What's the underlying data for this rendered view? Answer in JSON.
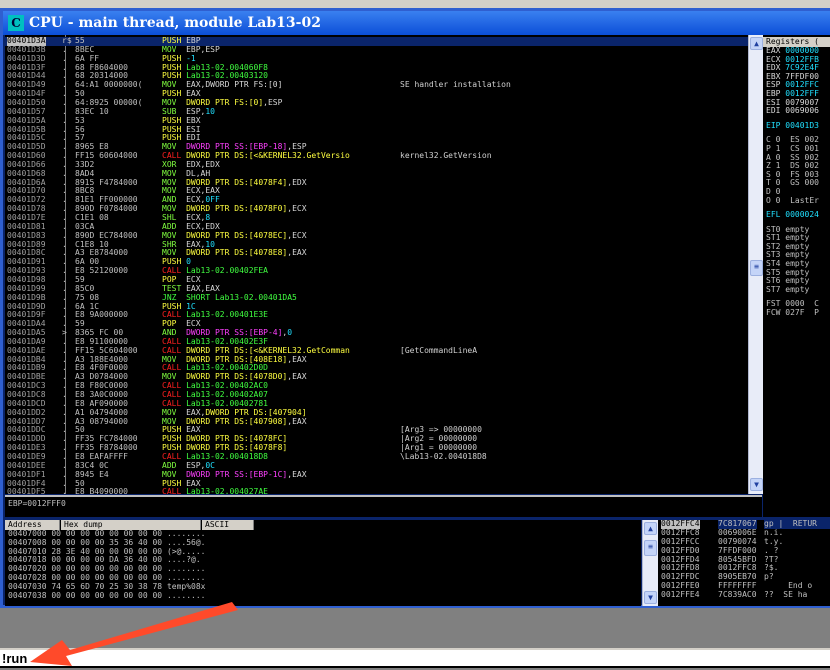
{
  "window": {
    "title": "CPU - main thread, module Lab13-02",
    "icon": "C"
  },
  "disasm": [
    [
      "00401D3A",
      "r$",
      "55",
      "PUSH",
      [
        [
          "EBP",
          "w"
        ]
      ],
      ""
    ],
    [
      "00401D3B",
      ".",
      "8BEC",
      "MOV",
      [
        [
          "EBP,ESP",
          "w"
        ]
      ],
      ""
    ],
    [
      "00401D3D",
      ".",
      "6A FF",
      "PUSH",
      [
        [
          "-1",
          "c"
        ]
      ],
      ""
    ],
    [
      "00401D3F",
      ".",
      "68 F8604000",
      "PUSH",
      [
        [
          "Lab13-02.004060F8",
          "g"
        ]
      ],
      ""
    ],
    [
      "00401D44",
      ".",
      "68 20314000",
      "PUSH",
      [
        [
          "Lab13-02.00403120",
          "g"
        ]
      ],
      ""
    ],
    [
      "00401D49",
      ".",
      "64:A1 0000000(",
      "MOV",
      [
        [
          "EAX,DWORD PTR FS:[0]",
          "w"
        ]
      ],
      "SE handler installation"
    ],
    [
      "00401D4F",
      ".",
      "50",
      "PUSH",
      [
        [
          "EAX",
          "w"
        ]
      ],
      ""
    ],
    [
      "00401D50",
      ".",
      "64:8925 00000(",
      "MOV",
      [
        [
          "DWORD PTR FS:[0]",
          "y"
        ],
        [
          ",ESP",
          "w"
        ]
      ],
      ""
    ],
    [
      "00401D57",
      ".",
      "83EC 10",
      "SUB",
      [
        [
          "ESP,",
          "w"
        ],
        [
          "10",
          "c"
        ]
      ],
      ""
    ],
    [
      "00401D5A",
      ".",
      "53",
      "PUSH",
      [
        [
          "EBX",
          "w"
        ]
      ],
      ""
    ],
    [
      "00401D5B",
      ".",
      "56",
      "PUSH",
      [
        [
          "ESI",
          "w"
        ]
      ],
      ""
    ],
    [
      "00401D5C",
      ".",
      "57",
      "PUSH",
      [
        [
          "EDI",
          "w"
        ]
      ],
      ""
    ],
    [
      "00401D5D",
      ".",
      "8965 E8",
      "MOV",
      [
        [
          "DWORD PTR SS:[EBP-18]",
          "m"
        ],
        [
          ",ESP",
          "w"
        ]
      ],
      ""
    ],
    [
      "00401D60",
      ".",
      "FF15 60604000",
      "CALL",
      [
        [
          "DWORD PTR DS:[<&KERNEL32.GetVersio",
          "y"
        ]
      ],
      "kernel32.GetVersion"
    ],
    [
      "00401D66",
      ".",
      "33D2",
      "XOR",
      [
        [
          "EDX,EDX",
          "w"
        ]
      ],
      ""
    ],
    [
      "00401D68",
      ".",
      "8AD4",
      "MOV",
      [
        [
          "DL,AH",
          "w"
        ]
      ],
      ""
    ],
    [
      "00401D6A",
      ".",
      "8915 F4784000",
      "MOV",
      [
        [
          "DWORD PTR DS:[4078F4]",
          "y"
        ],
        [
          ",EDX",
          "w"
        ]
      ],
      ""
    ],
    [
      "00401D70",
      ".",
      "8BC8",
      "MOV",
      [
        [
          "ECX,EAX",
          "w"
        ]
      ],
      ""
    ],
    [
      "00401D72",
      ".",
      "81E1 FF000000",
      "AND",
      [
        [
          "ECX,",
          "w"
        ],
        [
          "0FF",
          "c"
        ]
      ],
      ""
    ],
    [
      "00401D78",
      ".",
      "890D F0784000",
      "MOV",
      [
        [
          "DWORD PTR DS:[4078F0]",
          "y"
        ],
        [
          ",ECX",
          "w"
        ]
      ],
      ""
    ],
    [
      "00401D7E",
      ".",
      "C1E1 08",
      "SHL",
      [
        [
          "ECX,",
          "w"
        ],
        [
          "8",
          "c"
        ]
      ],
      ""
    ],
    [
      "00401D81",
      ".",
      "03CA",
      "ADD",
      [
        [
          "ECX,EDX",
          "w"
        ]
      ],
      ""
    ],
    [
      "00401D83",
      ".",
      "890D EC784000",
      "MOV",
      [
        [
          "DWORD PTR DS:[4078EC]",
          "y"
        ],
        [
          ",ECX",
          "w"
        ]
      ],
      ""
    ],
    [
      "00401D89",
      ".",
      "C1E8 10",
      "SHR",
      [
        [
          "EAX,",
          "w"
        ],
        [
          "10",
          "c"
        ]
      ],
      ""
    ],
    [
      "00401D8C",
      ".",
      "A3 E8784000",
      "MOV",
      [
        [
          "DWORD PTR DS:[4078E8]",
          "y"
        ],
        [
          ",EAX",
          "w"
        ]
      ],
      ""
    ],
    [
      "00401D91",
      ".",
      "6A 00",
      "PUSH",
      [
        [
          "0",
          "c"
        ]
      ],
      ""
    ],
    [
      "00401D93",
      ".",
      "E8 52120000",
      "CALL",
      [
        [
          "Lab13-02.00402FEA",
          "g"
        ]
      ],
      ""
    ],
    [
      "00401D98",
      ".",
      "59",
      "POP",
      [
        [
          "ECX",
          "w"
        ]
      ],
      ""
    ],
    [
      "00401D99",
      ".",
      "85C0",
      "TEST",
      [
        [
          "EAX,EAX",
          "w"
        ]
      ],
      ""
    ],
    [
      "00401D9B",
      ".",
      "75 08",
      "JNZ",
      [
        [
          "SHORT Lab13-02.00401DA5",
          "g"
        ]
      ],
      ""
    ],
    [
      "00401D9D",
      ".",
      "6A 1C",
      "PUSH",
      [
        [
          "1C",
          "c"
        ]
      ],
      ""
    ],
    [
      "00401D9F",
      ".",
      "E8 9A000000",
      "CALL",
      [
        [
          "Lab13-02.00401E3E",
          "g"
        ]
      ],
      ""
    ],
    [
      "00401DA4",
      ".",
      "59",
      "POP",
      [
        [
          "ECX",
          "w"
        ]
      ],
      ""
    ],
    [
      "00401DA5",
      ">",
      "8365 FC 00",
      "AND",
      [
        [
          "DWORD PTR SS:[EBP-4]",
          "m"
        ],
        [
          ",",
          "w"
        ],
        [
          "0",
          "c"
        ]
      ],
      ""
    ],
    [
      "00401DA9",
      ".",
      "E8 91100000",
      "CALL",
      [
        [
          "Lab13-02.00402E3F",
          "g"
        ]
      ],
      ""
    ],
    [
      "00401DAE",
      ".",
      "FF15 5C604000",
      "CALL",
      [
        [
          "DWORD PTR DS:[<&KERNEL32.GetComman",
          "y"
        ]
      ],
      "[GetCommandLineA"
    ],
    [
      "00401DB4",
      ".",
      "A3 188E4000",
      "MOV",
      [
        [
          "DWORD PTR DS:[408E18]",
          "y"
        ],
        [
          ",EAX",
          "w"
        ]
      ],
      ""
    ],
    [
      "00401DB9",
      ".",
      "E8 4F0F0000",
      "CALL",
      [
        [
          "Lab13-02.00402D0D",
          "g"
        ]
      ],
      ""
    ],
    [
      "00401DBE",
      ".",
      "A3 D0784000",
      "MOV",
      [
        [
          "DWORD PTR DS:[4078D0]",
          "y"
        ],
        [
          ",EAX",
          "w"
        ]
      ],
      ""
    ],
    [
      "00401DC3",
      ".",
      "E8 F80C0000",
      "CALL",
      [
        [
          "Lab13-02.00402AC0",
          "g"
        ]
      ],
      ""
    ],
    [
      "00401DC8",
      ".",
      "E8 3A0C0000",
      "CALL",
      [
        [
          "Lab13-02.00402A07",
          "g"
        ]
      ],
      ""
    ],
    [
      "00401DCD",
      ".",
      "E8 AF090000",
      "CALL",
      [
        [
          "Lab13-02.00402781",
          "g"
        ]
      ],
      ""
    ],
    [
      "00401DD2",
      ".",
      "A1 04794000",
      "MOV",
      [
        [
          "EAX,",
          "w"
        ],
        [
          "DWORD PTR DS:[407904]",
          "y"
        ]
      ],
      ""
    ],
    [
      "00401DD7",
      ".",
      "A3 08794000",
      "MOV",
      [
        [
          "DWORD PTR DS:[407908]",
          "y"
        ],
        [
          ",EAX",
          "w"
        ]
      ],
      ""
    ],
    [
      "00401DDC",
      ".",
      "50",
      "PUSH",
      [
        [
          "EAX",
          "w"
        ]
      ],
      "[Arg3 => 00000000"
    ],
    [
      "00401DDD",
      ".",
      "FF35 FC784000",
      "PUSH",
      [
        [
          "DWORD PTR DS:[4078FC]",
          "y"
        ]
      ],
      "|Arg2 = 00000000"
    ],
    [
      "00401DE3",
      ".",
      "FF35 F8784000",
      "PUSH",
      [
        [
          "DWORD PTR DS:[4078F8]",
          "y"
        ]
      ],
      "|Arg1 = 00000000"
    ],
    [
      "00401DE9",
      ".",
      "E8 EAFAFFFF",
      "CALL",
      [
        [
          "Lab13-02.004018D8",
          "g"
        ]
      ],
      "\\Lab13-02.004018D8"
    ],
    [
      "00401DEE",
      ".",
      "83C4 0C",
      "ADD",
      [
        [
          "ESP,",
          "w"
        ],
        [
          "0C",
          "c"
        ]
      ],
      ""
    ],
    [
      "00401DF1",
      ".",
      "8945 E4",
      "MOV",
      [
        [
          "DWORD PTR SS:[EBP-1C]",
          "m"
        ],
        [
          ",EAX",
          "w"
        ]
      ],
      ""
    ],
    [
      "00401DF4",
      ".",
      "50",
      "PUSH",
      [
        [
          "EAX",
          "w"
        ]
      ],
      ""
    ],
    [
      "00401DF5",
      ".",
      "E8 B4090000",
      "CALL",
      [
        [
          "Lab13-02.004027AE",
          "g"
        ]
      ],
      ""
    ],
    [
      "00401DFA",
      ".",
      "8B45 EC",
      "MOV",
      [
        [
          "EAX,",
          "w"
        ],
        [
          "DWORD PTR SS:[EBP-14]",
          "m"
        ]
      ],
      ""
    ]
  ],
  "info_line": "EBP=0012FFF0",
  "registers": {
    "header": "Registers (",
    "lines": [
      [
        "EAX ",
        "w"
      ],
      [
        "0000000",
        "c"
      ],
      [
        "ECX ",
        "w"
      ],
      [
        "0012FFB",
        "c"
      ],
      [
        "EDX ",
        "w"
      ],
      [
        "7C92E4F",
        "c"
      ],
      [
        "EBX ",
        "w"
      ],
      [
        "7FFDF00",
        "w"
      ],
      [
        "ESP ",
        "w"
      ],
      [
        "0012FFC",
        "c"
      ],
      [
        "EBP ",
        "w"
      ],
      [
        "0012FFF",
        "c"
      ],
      [
        "ESI ",
        "w"
      ],
      [
        "0079007",
        "w"
      ],
      [
        "EDI ",
        "w"
      ],
      [
        "0069006",
        "w"
      ]
    ],
    "eip": "EIP 00401D3",
    "flags": [
      "C 0  ES 002",
      "P 1  CS 001",
      "A 0  SS 002",
      "Z 1  DS 002",
      "S 0  FS 003",
      "T 0  GS 000",
      "D 0",
      "O 0  LastEr"
    ],
    "efl": "EFL 0000024",
    "fpu": [
      "ST0 empty",
      "ST1 empty",
      "ST2 empty",
      "ST3 empty",
      "ST4 empty",
      "ST5 empty",
      "ST6 empty",
      "ST7 empty"
    ],
    "fst": "FST 0000  C",
    "fcw": "FCW 027F  P"
  },
  "dump": {
    "headers": [
      "Address",
      "Hex dump",
      "ASCII"
    ],
    "rows": [
      "00407000 00 00 00 00 00 00 00 00 ........",
      "00407008 00 00 00 00 35 36 40 00 ....56@.",
      "00407010 28 3E 40 00 00 00 00 00 (>@.....",
      "00407018 00 00 00 00 DA 36 40 00 ....?@.",
      "00407020 00 00 00 00 00 00 00 00 ........",
      "00407028 00 00 00 00 00 00 00 00 ........",
      "00407030 74 65 6D 70 25 30 38 78 temp%08x",
      "00407038 00 00 00 00 00 00 00 00 ........"
    ]
  },
  "stack": [
    [
      "0012FFC4",
      "7C817067",
      "gp |  RETUR"
    ],
    [
      "0012FFC8",
      "0069006E",
      "n.i."
    ],
    [
      "0012FFCC",
      "00790074",
      "t.y."
    ],
    [
      "0012FFD0",
      "7FFDF000",
      ". ?"
    ],
    [
      "0012FFD4",
      "80545BFD",
      "?T?"
    ],
    [
      "0012FFD8",
      "0012FFC8",
      "?$."
    ],
    [
      "0012FFDC",
      "8905EB70",
      "p?"
    ],
    [
      "0012FFE0",
      "FFFFFFFF",
      "     End o"
    ],
    [
      "0012FFE4",
      "7C839AC0",
      "??  SE ha"
    ]
  ],
  "command": {
    "value": "!run"
  },
  "colors": {
    "titlebar": "#0b4fd8",
    "annotation_arrow": "#ff4a2a",
    "background": "#000000"
  }
}
